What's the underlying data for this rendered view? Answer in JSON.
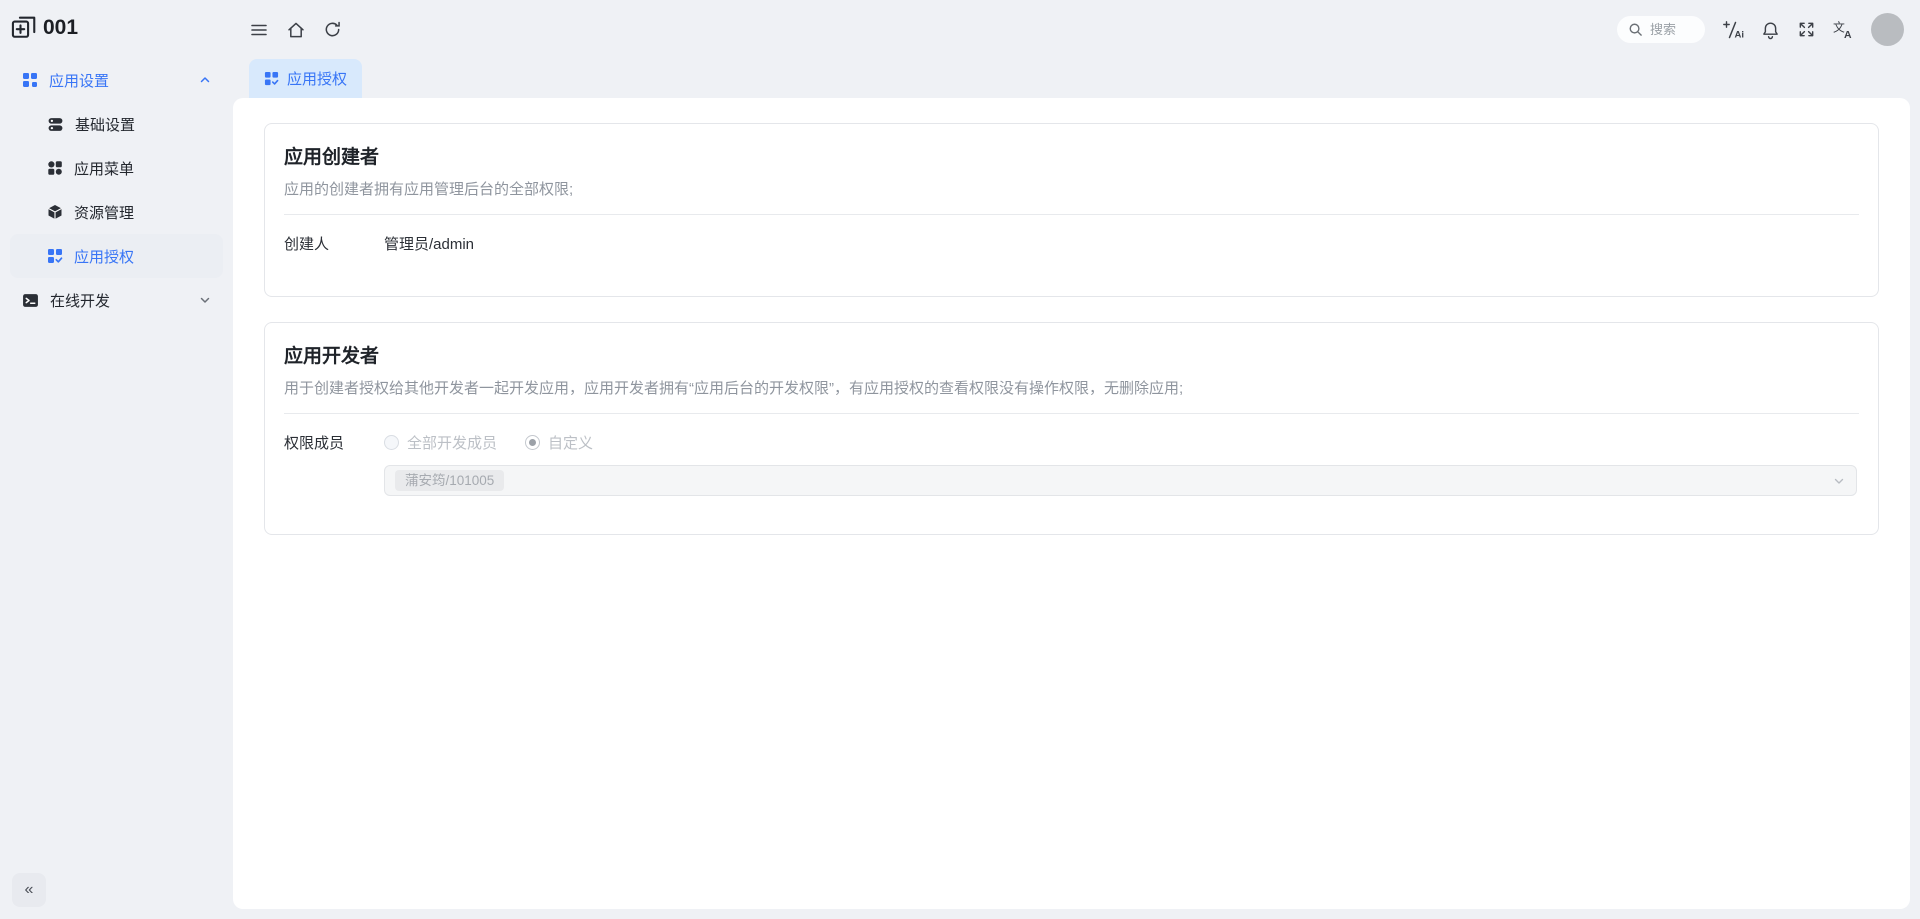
{
  "app": {
    "name": "001"
  },
  "header": {
    "search_placeholder": "搜索"
  },
  "sidebar": {
    "group_settings": {
      "label": "应用设置",
      "expanded": true
    },
    "items": [
      {
        "label": "基础设置"
      },
      {
        "label": "应用菜单"
      },
      {
        "label": "资源管理"
      },
      {
        "label": "应用授权",
        "active": true
      }
    ],
    "group_dev": {
      "label": "在线开发",
      "expanded": false
    },
    "collapse_label": "«"
  },
  "tabs": {
    "app_auth": {
      "label": "应用授权",
      "active": true
    }
  },
  "cards": {
    "creator": {
      "title": "应用创建者",
      "description": "应用的创建者拥有应用管理后台的全部权限;",
      "field_label": "创建人",
      "field_value": "管理员/admin"
    },
    "developer": {
      "title": "应用开发者",
      "description": "用于创建者授权给其他开发者一起开发应用，应用开发者拥有“应用后台的开发权限”，有应用授权的查看权限没有操作权限，无删除应用;",
      "field_label": "权限成员",
      "radio_all_label": "全部开发成员",
      "radio_custom_label": "自定义",
      "radio_selected": "自定义",
      "member_tag": "蒲安筠/101005"
    }
  },
  "colors": {
    "accent": "#3875f6",
    "active_tab_bg": "#d8e9fc",
    "page_bg": "#eff1f5"
  }
}
